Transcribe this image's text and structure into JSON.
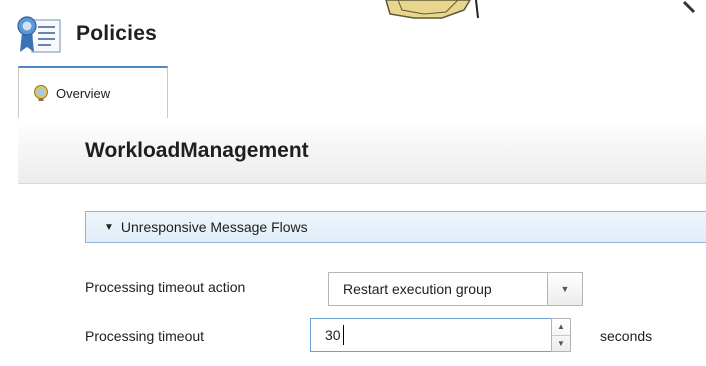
{
  "header": {
    "title": "Policies",
    "icon": "policies-icon"
  },
  "tabs": [
    {
      "label": "Overview",
      "icon": "overview-icon",
      "active": true
    }
  ],
  "main": {
    "title": "WorkloadManagement",
    "section": {
      "label": "Unresponsive Message Flows",
      "expanded": true
    },
    "fields": {
      "action": {
        "label": "Processing timeout action",
        "value": "Restart execution group"
      },
      "timeout": {
        "label": "Processing timeout",
        "value": "30",
        "unit": "seconds"
      }
    }
  },
  "colors": {
    "accent": "#4b88c8",
    "section_bg": "#e6f0fa",
    "section_border": "#8fb3d9"
  }
}
